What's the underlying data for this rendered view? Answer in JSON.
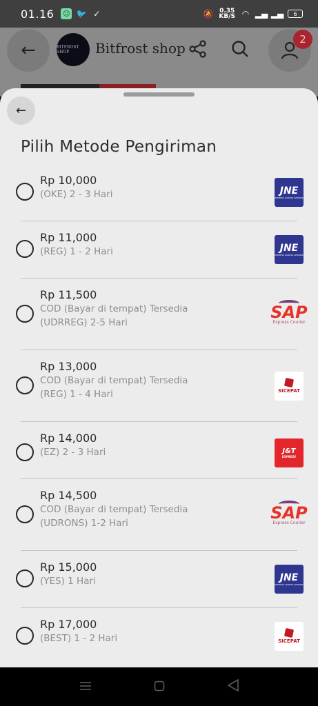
{
  "status_bar": {
    "time": "01.16",
    "speed_value": "0.35",
    "speed_unit": "KB/S",
    "battery": "6"
  },
  "header": {
    "logo_text": "BITFROST SHOP",
    "shop_name": "Bitfrost shop",
    "cart_badge": "2"
  },
  "sheet": {
    "title": "Pilih Metode Pengiriman",
    "options": [
      {
        "price": "Rp 10,000",
        "line1": "(OKE) 2 - 3 Hari",
        "line2": "",
        "courier": "JNE"
      },
      {
        "price": "Rp 11,000",
        "line1": "(REG) 1 - 2 Hari",
        "line2": "",
        "courier": "JNE"
      },
      {
        "price": "Rp 11,500",
        "line1": "COD (Bayar di tempat) Tersedia",
        "line2": "(UDRREG) 2-5 Hari",
        "courier": "SAP"
      },
      {
        "price": "Rp 13,000",
        "line1": "COD (Bayar di tempat) Tersedia",
        "line2": "(REG) 1 - 4 Hari",
        "courier": "SICEPAT"
      },
      {
        "price": "Rp 14,000",
        "line1": "(EZ) 2 - 3 Hari",
        "line2": "",
        "courier": "J&T"
      },
      {
        "price": "Rp 14,500",
        "line1": "COD (Bayar di tempat) Tersedia",
        "line2": "(UDRONS) 1-2 Hari",
        "courier": "SAP"
      },
      {
        "price": "Rp 15,000",
        "line1": "(YES) 1 Hari",
        "line2": "",
        "courier": "JNE"
      },
      {
        "price": "Rp 17,000",
        "line1": "(BEST) 1 - 2 Hari",
        "line2": "",
        "courier": "SICEPAT"
      }
    ],
    "logo_labels": {
      "jne": "JNE",
      "jne_tag": "EXPRESS ACROSS NATIONS",
      "sap": "SAP",
      "sap_tag": "Express Courier",
      "sicepat": "SICEPAT",
      "jnt": "J&T",
      "jnt_tag": "EXPRESS"
    }
  },
  "colors": {
    "sheet_bg": "#ececec",
    "jne": "#2e3690",
    "jnt": "#e2262b",
    "sicepat": "#c21a22",
    "sap": "#e5332a",
    "badge": "#a8242f"
  },
  "icons": {
    "back": "arrow-left-icon",
    "share": "share-icon",
    "search": "search-icon",
    "account": "user-icon",
    "nav_recents": "menu-icon",
    "nav_home": "square-icon",
    "nav_back": "triangle-back-icon"
  }
}
